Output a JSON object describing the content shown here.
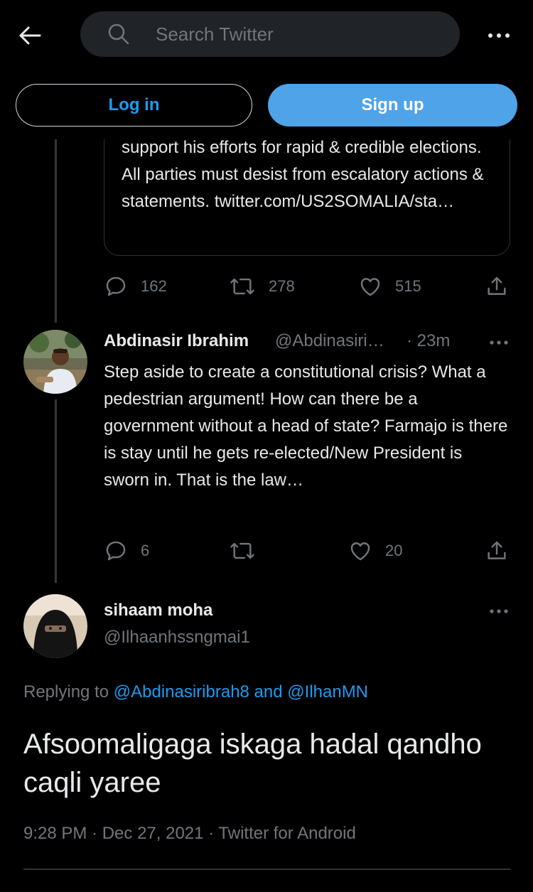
{
  "topbar": {
    "back_icon": "arrow-left-icon",
    "search_placeholder": "Search Twitter",
    "more_icon": "more-horizontal-icon"
  },
  "auth": {
    "login_label": "Log in",
    "signup_label": "Sign up"
  },
  "quoted_tweet": {
    "text": "support his efforts for rapid & credible elections. All parties must desist from escalatory actions & statements. twitter.com/US2SOMALIA/sta…",
    "replies": "162",
    "retweets": "278",
    "likes": "515"
  },
  "reply_tweet": {
    "author_name": "Abdinasir Ibrahim",
    "author_handle": "@Abdinasiri…",
    "time": "· 23m",
    "text": "Step aside to create a constitutional crisis? What a pedestrian argument! How can there be a government without a head of state? Farmajo is there is stay until he gets re-elected/New President is sworn in. That is the law…",
    "replies": "6",
    "retweets": "",
    "likes": "20"
  },
  "main_tweet": {
    "author_name": "sihaam moha",
    "author_handle": "@Ilhaanhssngmai1",
    "replying_prefix": "Replying to ",
    "replying_user1": "@Abdinasiribrah8",
    "replying_and": " and ",
    "replying_user2": "@IlhanMN",
    "text": "Afsoomaligaga iskaga hadal qandho caqli yaree",
    "time": "9:28 PM",
    "date": "Dec 27, 2021",
    "source": "Twitter for Android",
    "meta_separator": " · "
  },
  "colors": {
    "background": "#000000",
    "text_primary": "#e7e9ea",
    "text_secondary": "#71767b",
    "accent": "#1d9bf0",
    "signup_bg": "#4fa3e8",
    "border": "#2f3336",
    "search_bg": "#202327"
  }
}
